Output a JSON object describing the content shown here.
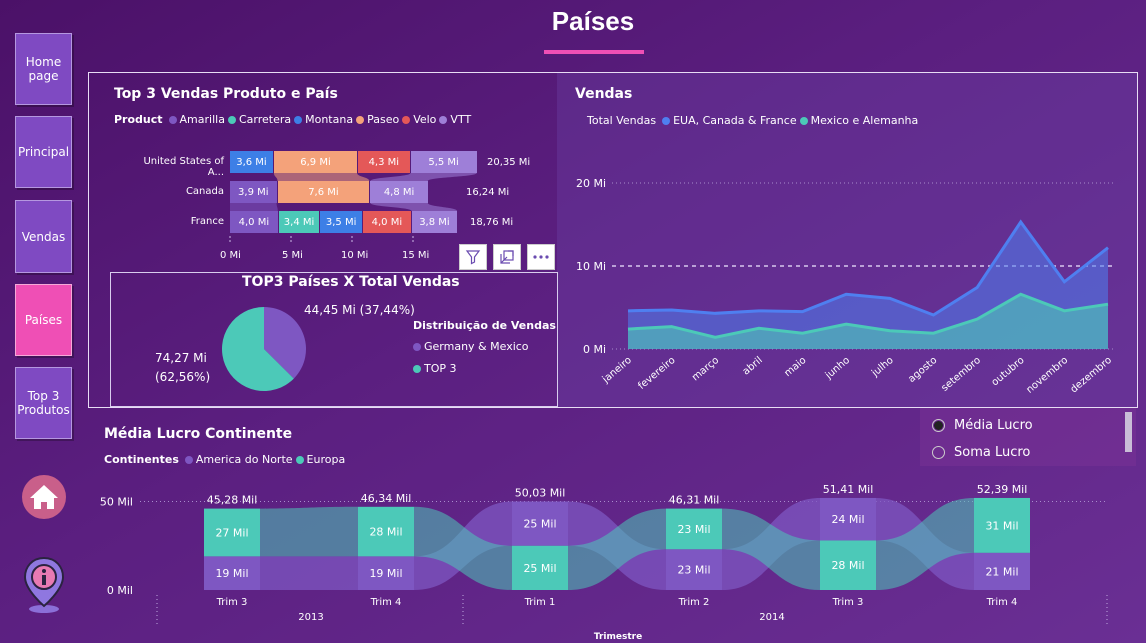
{
  "page": {
    "title": "Países"
  },
  "nav": {
    "items": [
      {
        "label": "Home page",
        "active": false
      },
      {
        "label": "Principal",
        "active": false
      },
      {
        "label": "Vendas",
        "active": false
      },
      {
        "label": "Países",
        "active": true
      },
      {
        "label": "Top 3 Produtos",
        "active": false
      }
    ]
  },
  "colors": {
    "amarilla": "#7e57c2",
    "carretera": "#4cc9b8",
    "montana": "#3d7fe6",
    "paseo": "#f4a27a",
    "velo": "#e45858",
    "vtt": "#9e7fd8",
    "accent_pink": "#ef4fb5",
    "usa_series": "#4f7ff0",
    "mex_series": "#4cc9b8"
  },
  "top3": {
    "title": "Top 3 Vendas Produto e País",
    "legend_label": "Product",
    "products": [
      {
        "name": "Amarilla",
        "color": "#7e57c2"
      },
      {
        "name": "Carretera",
        "color": "#4cc9b8"
      },
      {
        "name": "Montana",
        "color": "#3d7fe6"
      },
      {
        "name": "Paseo",
        "color": "#f4a27a"
      },
      {
        "name": "Velo",
        "color": "#e45858"
      },
      {
        "name": "VTT",
        "color": "#9e7fd8"
      }
    ],
    "rows": [
      {
        "country": "United States of A...",
        "total": "20,35 Mi"
      },
      {
        "country": "Canada",
        "total": "16,24 Mi"
      },
      {
        "country": "France",
        "total": "18,76 Mi"
      }
    ],
    "axis_ticks": [
      "0 Mi",
      "5 Mi",
      "10 Mi",
      "15 Mi"
    ],
    "tools": [
      "filter-icon",
      "focus-mode-icon",
      "more-options-icon"
    ]
  },
  "chart_data": [
    {
      "type": "bar",
      "orientation": "horizontal-stacked",
      "title": "Top 3 Vendas Produto e País",
      "legend_title": "Product",
      "categories": [
        "United States of A...",
        "Canada",
        "France"
      ],
      "series": [
        {
          "name": "Montana",
          "values": [
            3.6,
            null,
            3.5
          ]
        },
        {
          "name": "Paseo",
          "values": [
            6.9,
            7.6,
            null
          ]
        },
        {
          "name": "Velo",
          "values": [
            4.3,
            null,
            4.0
          ]
        },
        {
          "name": "VTT",
          "values": [
            5.5,
            4.8,
            3.8
          ]
        },
        {
          "name": "Amarilla",
          "values": [
            null,
            3.9,
            4.0
          ]
        },
        {
          "name": "Carretera",
          "values": [
            null,
            null,
            3.4
          ]
        }
      ],
      "segments": [
        [
          {
            "product": "Montana",
            "value": 3.6,
            "label": "3,6 Mi"
          },
          {
            "product": "Paseo",
            "value": 6.9,
            "label": "6,9 Mi"
          },
          {
            "product": "Velo",
            "value": 4.3,
            "label": "4,3 Mi"
          },
          {
            "product": "VTT",
            "value": 5.5,
            "label": "5,5 Mi"
          }
        ],
        [
          {
            "product": "Amarilla",
            "value": 3.9,
            "label": "3,9 Mi"
          },
          {
            "product": "Paseo",
            "value": 7.6,
            "label": "7,6 Mi"
          },
          {
            "product": "VTT",
            "value": 4.8,
            "label": "4,8 Mi"
          }
        ],
        [
          {
            "product": "Amarilla",
            "value": 4.0,
            "label": "4,0 Mi"
          },
          {
            "product": "Carretera",
            "value": 3.4,
            "label": "3,4 Mi"
          },
          {
            "product": "Montana",
            "value": 3.5,
            "label": "3,5 Mi"
          },
          {
            "product": "Velo",
            "value": 4.0,
            "label": "4,0 Mi"
          },
          {
            "product": "VTT",
            "value": 3.8,
            "label": "3,8 Mi"
          }
        ]
      ],
      "totals": [
        "20,35 Mi",
        "16,24 Mi",
        "18,76 Mi"
      ],
      "xlim": [
        0,
        20
      ],
      "xticks": [
        "0 Mi",
        "5 Mi",
        "10 Mi",
        "15 Mi"
      ]
    },
    {
      "type": "pie",
      "title": "TOP3 Países X Total Vendas",
      "legend_title": "Distribuição de Vendas",
      "slices": [
        {
          "name": "Germany & Mexico",
          "value": 44.45,
          "percent": 37.44,
          "color": "#7e57c2"
        },
        {
          "name": "TOP 3",
          "value": 74.27,
          "percent": 62.56,
          "color": "#4cc9b8"
        }
      ]
    },
    {
      "type": "area",
      "title": "Vendas",
      "legend_title": "Total Vendas",
      "x": [
        "janeiro",
        "fevereiro",
        "março",
        "abril",
        "maio",
        "junho",
        "julho",
        "agosto",
        "setembro",
        "outubro",
        "novembro",
        "dezembro"
      ],
      "series": [
        {
          "name": "EUA, Canada & France",
          "color": "#4f7ff0",
          "values": [
            4.6,
            4.7,
            4.3,
            4.6,
            4.5,
            6.6,
            6.1,
            4.1,
            7.4,
            15.3,
            8.1,
            12.2
          ]
        },
        {
          "name": "Mexico e Alemanha",
          "color": "#4cc9b8",
          "values": [
            2.4,
            2.7,
            1.4,
            2.5,
            1.9,
            3.0,
            2.2,
            1.9,
            3.6,
            6.6,
            4.6,
            5.4
          ]
        }
      ],
      "ylim": [
        0,
        20
      ],
      "yticks": [
        "0 Mi",
        "10 Mi",
        "20 Mi"
      ],
      "reference_line": 10
    },
    {
      "type": "bar",
      "orientation": "vertical-stacked-ribbon",
      "title": "Média Lucro Continente",
      "legend_title": "Continentes",
      "x_axis_title": "Trimestre",
      "categories": [
        "Trim 3",
        "Trim 4",
        "Trim 1",
        "Trim 2",
        "Trim 3",
        "Trim 4"
      ],
      "year_groups": [
        {
          "label": "2013",
          "span": [
            0,
            1
          ]
        },
        {
          "label": "2014",
          "span": [
            2,
            5
          ]
        }
      ],
      "series": [
        {
          "name": "America do Norte",
          "color": "#7e57c2",
          "values": [
            19,
            19,
            25,
            23,
            24,
            21
          ],
          "labels": [
            "19 Mil",
            "19 Mil",
            "25 Mil",
            "23 Mil",
            "24 Mil",
            "21 Mil"
          ]
        },
        {
          "name": "Europa",
          "color": "#4cc9b8",
          "values": [
            27,
            28,
            25,
            23,
            28,
            31
          ],
          "labels": [
            "27 Mil",
            "28 Mil",
            "25 Mil",
            "23 Mil",
            "28 Mil",
            "31 Mil"
          ]
        }
      ],
      "top_order": [
        "Europa",
        "Europa",
        "America do Norte",
        "Europa",
        "America do Norte",
        "Europa"
      ],
      "totals": [
        45.28,
        46.34,
        50.03,
        46.31,
        51.41,
        52.39
      ],
      "total_labels": [
        "45,28 Mil",
        "46,34 Mil",
        "50,03 Mil",
        "46,31 Mil",
        "51,41 Mil",
        "52,39 Mil"
      ],
      "ylim": [
        0,
        50
      ],
      "yticks": [
        "0 Mil",
        "50 Mil"
      ]
    }
  ],
  "pie": {
    "title": "TOP3 Países X Total Vendas",
    "legend_title": "Distribuição de Vendas",
    "items": [
      {
        "label": "Germany & Mexico",
        "color": "#7e57c2",
        "value_label": "44,45 Mi (37,44%)"
      },
      {
        "label": "TOP 3",
        "color": "#4cc9b8",
        "value_label_line1": "74,27 Mi",
        "value_label_line2": "(62,56%)"
      }
    ]
  },
  "vendas": {
    "title": "Vendas",
    "legend_label": "Total Vendas",
    "series": [
      {
        "name": "EUA, Canada & France",
        "color": "#4f7ff0"
      },
      {
        "name": "Mexico e Alemanha",
        "color": "#4cc9b8"
      }
    ]
  },
  "lucro": {
    "title": "Média Lucro Continente",
    "legend_label": "Continentes",
    "series": [
      {
        "name": "America do Norte",
        "color": "#7e57c2"
      },
      {
        "name": "Europa",
        "color": "#4cc9b8"
      }
    ],
    "x_axis_title": "Trimestre",
    "years": [
      "2013",
      "2014"
    ]
  },
  "slicer": {
    "options": [
      {
        "label": "Média Lucro",
        "selected": true
      },
      {
        "label": "Soma Lucro",
        "selected": false
      }
    ]
  },
  "bottom_icons": [
    "home-icon",
    "info-location-icon"
  ]
}
